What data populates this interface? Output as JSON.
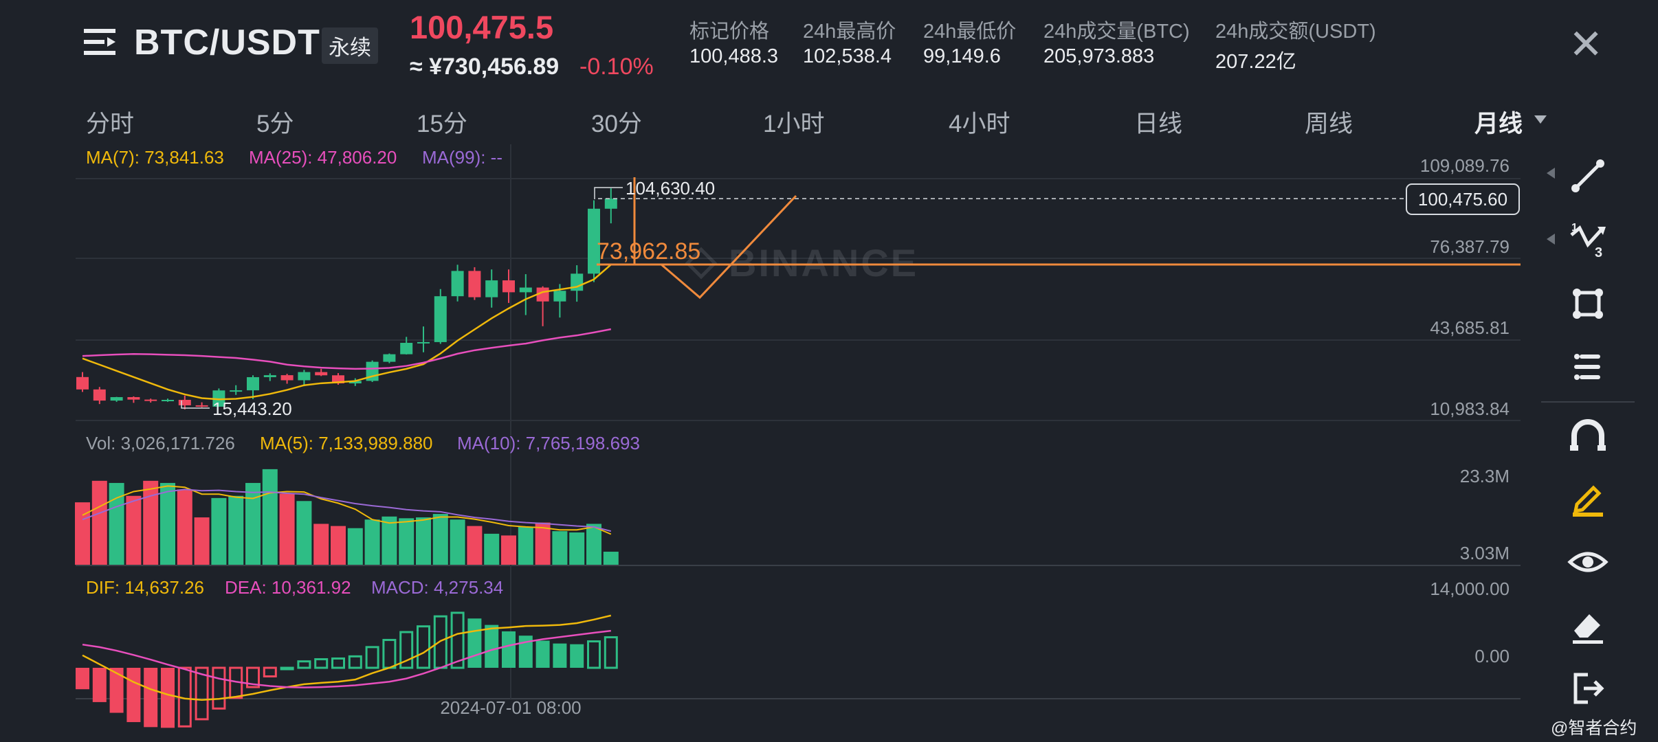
{
  "header": {
    "symbol": "BTC/USDT",
    "contract_tag": "永续",
    "last_price": "100,475.5",
    "cny_price": "≈ ¥730,456.89",
    "change_pct": "-0.10%",
    "stats": [
      {
        "label": "标记价格",
        "value": "100,488.3"
      },
      {
        "label": "24h最高价",
        "value": "102,538.4"
      },
      {
        "label": "24h最低价",
        "value": "99,149.6"
      },
      {
        "label": "24h成交量(BTC)",
        "value": "205,973.883"
      },
      {
        "label": "24h成交额(USDT)",
        "value": "207.22亿"
      }
    ],
    "close_symbol": "✕"
  },
  "timeframes": [
    "分时",
    "5分",
    "15分",
    "30分",
    "1小时",
    "4小时",
    "日线",
    "周线",
    "月线"
  ],
  "active_timeframe": "月线",
  "indicators": {
    "ma7": "MA(7): 73,841.63",
    "ma25": "MA(25): 47,806.20",
    "ma99": "MA(99): --",
    "vol": "Vol: 3,026,171.726",
    "vol_ma5": "MA(5): 7,133,989.880",
    "vol_ma10": "MA(10): 7,765,198.693",
    "dif": "DIF: 14,637.26",
    "dea": "DEA: 10,361.92",
    "macd": "MACD: 4,275.34"
  },
  "price_axis": [
    "109,089.76",
    "76,387.79",
    "43,685.81",
    "10,983.84"
  ],
  "vol_axis": [
    "23.3M",
    "3.03M"
  ],
  "macd_axis": [
    "14,000.00",
    "0.00"
  ],
  "annotations": {
    "high_label": "104,630.40",
    "low_label": "15,443.20",
    "current_price_tag": "100,475.60",
    "drawn_level": "73,962.85",
    "time_label": "2024-07-01 08:00"
  },
  "brand_watermark": "BINANCE",
  "credit": "@智者合约",
  "colors": {
    "up": "#2ebd85",
    "down": "#f0485f",
    "ma7": "#f0b90b",
    "ma25": "#e84fbd",
    "ma99": "#9b6ad6",
    "drawing": "#f08a3c",
    "background": "#1e2229"
  },
  "side_tools": [
    "trendline-icon",
    "fib-icon",
    "rectangle-icon",
    "text-lines-icon",
    "magnet-icon",
    "pencil-icon",
    "eye-icon",
    "eraser-icon",
    "exit-icon"
  ],
  "chart_data": {
    "type": "candlestick",
    "interval": "1M",
    "price_range": [
      10983.84,
      109089.76
    ],
    "candles": [
      {
        "o": 28500,
        "h": 30500,
        "l": 22500,
        "c": 23500
      },
      {
        "o": 23500,
        "h": 24500,
        "l": 17600,
        "c": 19000
      },
      {
        "o": 19000,
        "h": 20500,
        "l": 18500,
        "c": 20400
      },
      {
        "o": 20400,
        "h": 20700,
        "l": 18100,
        "c": 19400
      },
      {
        "o": 19400,
        "h": 19800,
        "l": 18200,
        "c": 19300
      },
      {
        "o": 19300,
        "h": 19800,
        "l": 18500,
        "c": 19300
      },
      {
        "o": 19300,
        "h": 21000,
        "l": 15443,
        "c": 17100
      },
      {
        "o": 17100,
        "h": 18300,
        "l": 16300,
        "c": 16550
      },
      {
        "o": 16550,
        "h": 23900,
        "l": 16500,
        "c": 23100
      },
      {
        "o": 23100,
        "h": 25200,
        "l": 21300,
        "c": 23150
      },
      {
        "o": 23150,
        "h": 29200,
        "l": 19600,
        "c": 28450
      },
      {
        "o": 28450,
        "h": 30000,
        "l": 26900,
        "c": 29250
      },
      {
        "o": 29250,
        "h": 29800,
        "l": 25800,
        "c": 27200
      },
      {
        "o": 27200,
        "h": 31400,
        "l": 24800,
        "c": 30500
      },
      {
        "o": 30500,
        "h": 31800,
        "l": 28900,
        "c": 29200
      },
      {
        "o": 29200,
        "h": 30100,
        "l": 25400,
        "c": 25950
      },
      {
        "o": 25950,
        "h": 28000,
        "l": 24900,
        "c": 26950
      },
      {
        "o": 26950,
        "h": 35200,
        "l": 26500,
        "c": 34650
      },
      {
        "o": 34650,
        "h": 38000,
        "l": 34100,
        "c": 37700
      },
      {
        "o": 37700,
        "h": 44700,
        "l": 37600,
        "c": 42300
      },
      {
        "o": 42300,
        "h": 48900,
        "l": 38500,
        "c": 42600
      },
      {
        "o": 42600,
        "h": 64000,
        "l": 41900,
        "c": 61100
      },
      {
        "o": 61100,
        "h": 73800,
        "l": 59000,
        "c": 71300
      },
      {
        "o": 71300,
        "h": 72800,
        "l": 59600,
        "c": 60700
      },
      {
        "o": 60700,
        "h": 71900,
        "l": 56500,
        "c": 67500
      },
      {
        "o": 67500,
        "h": 71900,
        "l": 58400,
        "c": 62700
      },
      {
        "o": 62700,
        "h": 70000,
        "l": 53500,
        "c": 64600
      },
      {
        "o": 64600,
        "h": 65100,
        "l": 49000,
        "c": 59000
      },
      {
        "o": 59000,
        "h": 66000,
        "l": 52500,
        "c": 63300
      },
      {
        "o": 63300,
        "h": 73600,
        "l": 58900,
        "c": 70200
      },
      {
        "o": 70200,
        "h": 99800,
        "l": 66800,
        "c": 96400
      },
      {
        "o": 96400,
        "h": 104630.4,
        "l": 90500,
        "c": 100475.6
      }
    ],
    "volume": [
      14.5,
      19.5,
      19.0,
      16.0,
      19.5,
      19.0,
      17.5,
      11.0,
      15.5,
      16.0,
      19.0,
      22.2,
      16.5,
      14.8,
      9.5,
      9.0,
      8.5,
      10.5,
      11.2,
      10.8,
      11.0,
      11.8,
      10.5,
      9.0,
      7.2,
      6.8,
      8.8,
      9.8,
      7.8,
      7.5,
      9.5,
      3.03
    ],
    "volume_range": [
      0,
      23.3
    ],
    "vol_ma5": [
      11.5,
      13.5,
      15.5,
      17.0,
      17.6,
      18.3,
      18.0,
      16.4,
      16.4,
      15.7,
      15.4,
      16.7,
      17.0,
      16.9,
      15.3,
      14.3,
      12.9,
      10.5,
      9.7,
      10.0,
      10.4,
      11.1,
      11.1,
      10.6,
      9.9,
      9.1,
      8.8,
      8.6,
      8.1,
      8.1,
      8.8,
      7.1
    ],
    "vol_ma10": [
      10.5,
      12.0,
      13.5,
      14.8,
      16.0,
      17.0,
      17.5,
      17.2,
      17.3,
      17.0,
      16.8,
      16.9,
      16.6,
      16.4,
      15.6,
      14.9,
      14.2,
      13.7,
      13.3,
      12.8,
      12.5,
      12.3,
      11.6,
      11.0,
      10.6,
      10.1,
      9.8,
      9.6,
      9.3,
      9.0,
      8.8,
      7.8
    ],
    "ma7": [
      36000,
      33500,
      31000,
      28500,
      26000,
      23500,
      21500,
      20000,
      19500,
      19700,
      20500,
      21700,
      23300,
      25200,
      26000,
      26400,
      26900,
      28800,
      30400,
      31800,
      33700,
      38000,
      43200,
      47700,
      52200,
      56200,
      59900,
      62800,
      63800,
      64900,
      67900,
      73841.63
    ],
    "ma25": [
      37000,
      37300,
      37600,
      37800,
      37700,
      37500,
      37300,
      37000,
      36600,
      36200,
      35500,
      34700,
      33500,
      32800,
      32300,
      32000,
      31800,
      31900,
      32200,
      33000,
      34300,
      36000,
      37900,
      39300,
      40300,
      41200,
      42000,
      43300,
      44400,
      45300,
      46500,
      47806.2
    ],
    "macd_range": [
      -12000,
      14000
    ],
    "dif": [
      3500,
      1000,
      -1500,
      -4000,
      -6000,
      -7500,
      -8600,
      -9000,
      -8700,
      -8100,
      -7300,
      -6300,
      -5400,
      -4600,
      -4200,
      -3900,
      -3300,
      -1500,
      0,
      2000,
      4200,
      7500,
      9500,
      10300,
      11000,
      11300,
      11700,
      11800,
      12000,
      12500,
      13500,
      14637.26
    ],
    "dea": [
      6500,
      5800,
      4800,
      3600,
      2300,
      900,
      -400,
      -1800,
      -3000,
      -3900,
      -4600,
      -5100,
      -5400,
      -5500,
      -5400,
      -5200,
      -4900,
      -4400,
      -3900,
      -3000,
      -1600,
      0,
      1800,
      3400,
      5000,
      6200,
      7200,
      8000,
      8600,
      9200,
      9800,
      10361.92
    ],
    "macd": [
      -6000,
      -9600,
      -12600,
      -15200,
      -16600,
      -16800,
      -16400,
      -14400,
      -11400,
      -8400,
      -5400,
      -2400,
      0,
      1800,
      2400,
      2600,
      3200,
      5800,
      7800,
      10000,
      11600,
      14400,
      15400,
      13800,
      12000,
      10200,
      9000,
      7600,
      6800,
      6600,
      7400,
      8550
    ]
  }
}
